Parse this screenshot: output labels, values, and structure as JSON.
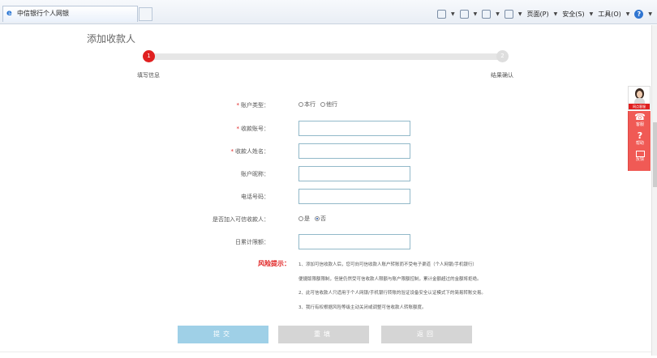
{
  "browser": {
    "tab_title": "中信银行个人网银",
    "commands": [
      "页面(P)",
      "安全(S)",
      "工具(O)"
    ]
  },
  "page": {
    "title": "添加收款人"
  },
  "stepper": {
    "steps": [
      {
        "number": "1",
        "label": "填写信息",
        "state": "active"
      },
      {
        "number": "2",
        "label": "结果确认",
        "state": "pending"
      }
    ]
  },
  "form": {
    "account_type": {
      "label": "账户类型：",
      "required": true,
      "options": [
        "本行",
        "他行"
      ],
      "selected": null
    },
    "account_no": {
      "label": "收款账号：",
      "required": true,
      "value": ""
    },
    "payee_name": {
      "label": "收款人姓名：",
      "required": true,
      "value": ""
    },
    "nickname": {
      "label": "账户昵称：",
      "required": false,
      "value": ""
    },
    "phone": {
      "label": "电话号码：",
      "required": false,
      "value": ""
    },
    "trusted": {
      "label": "是否加入可信收款人：",
      "required": false,
      "options": [
        "是",
        "否"
      ],
      "selected": "否"
    },
    "daily_limit": {
      "label": "日累计限额：",
      "required": false,
      "value": ""
    }
  },
  "risk": {
    "title": "风险提示：",
    "lines": [
      "1、添加可信收款人后，您可向可信收款人账户转账而不受电子渠道（个人网银/手机银行）",
      "便捷版限额限制，但是仍然受可信收款人限额与账户限额控制，累计金额超过的金额将拒绝。",
      "2、此可信收款人只适用于个人网银/手机银行转账的验证设备安全认证模式下的简易转账交易。",
      "3、我行有权根据风险等级主动关闭或调整可信收款人转账额度。"
    ]
  },
  "buttons": {
    "submit": "提交",
    "reset": "重填",
    "back": "返回"
  },
  "side_panel": {
    "avatar_caption": "网点客服",
    "items": [
      {
        "icon": "headset-icon",
        "label": "客服"
      },
      {
        "icon": "help-icon",
        "label": "帮助"
      },
      {
        "icon": "mail-icon",
        "label": "反馈"
      }
    ]
  },
  "colors": {
    "accent_red": "#e02020",
    "submit_blue": "#9fd0e7",
    "disabled_grey": "#d5d5d5",
    "side_panel": "#f05a55",
    "field_border": "#92b9c9"
  }
}
